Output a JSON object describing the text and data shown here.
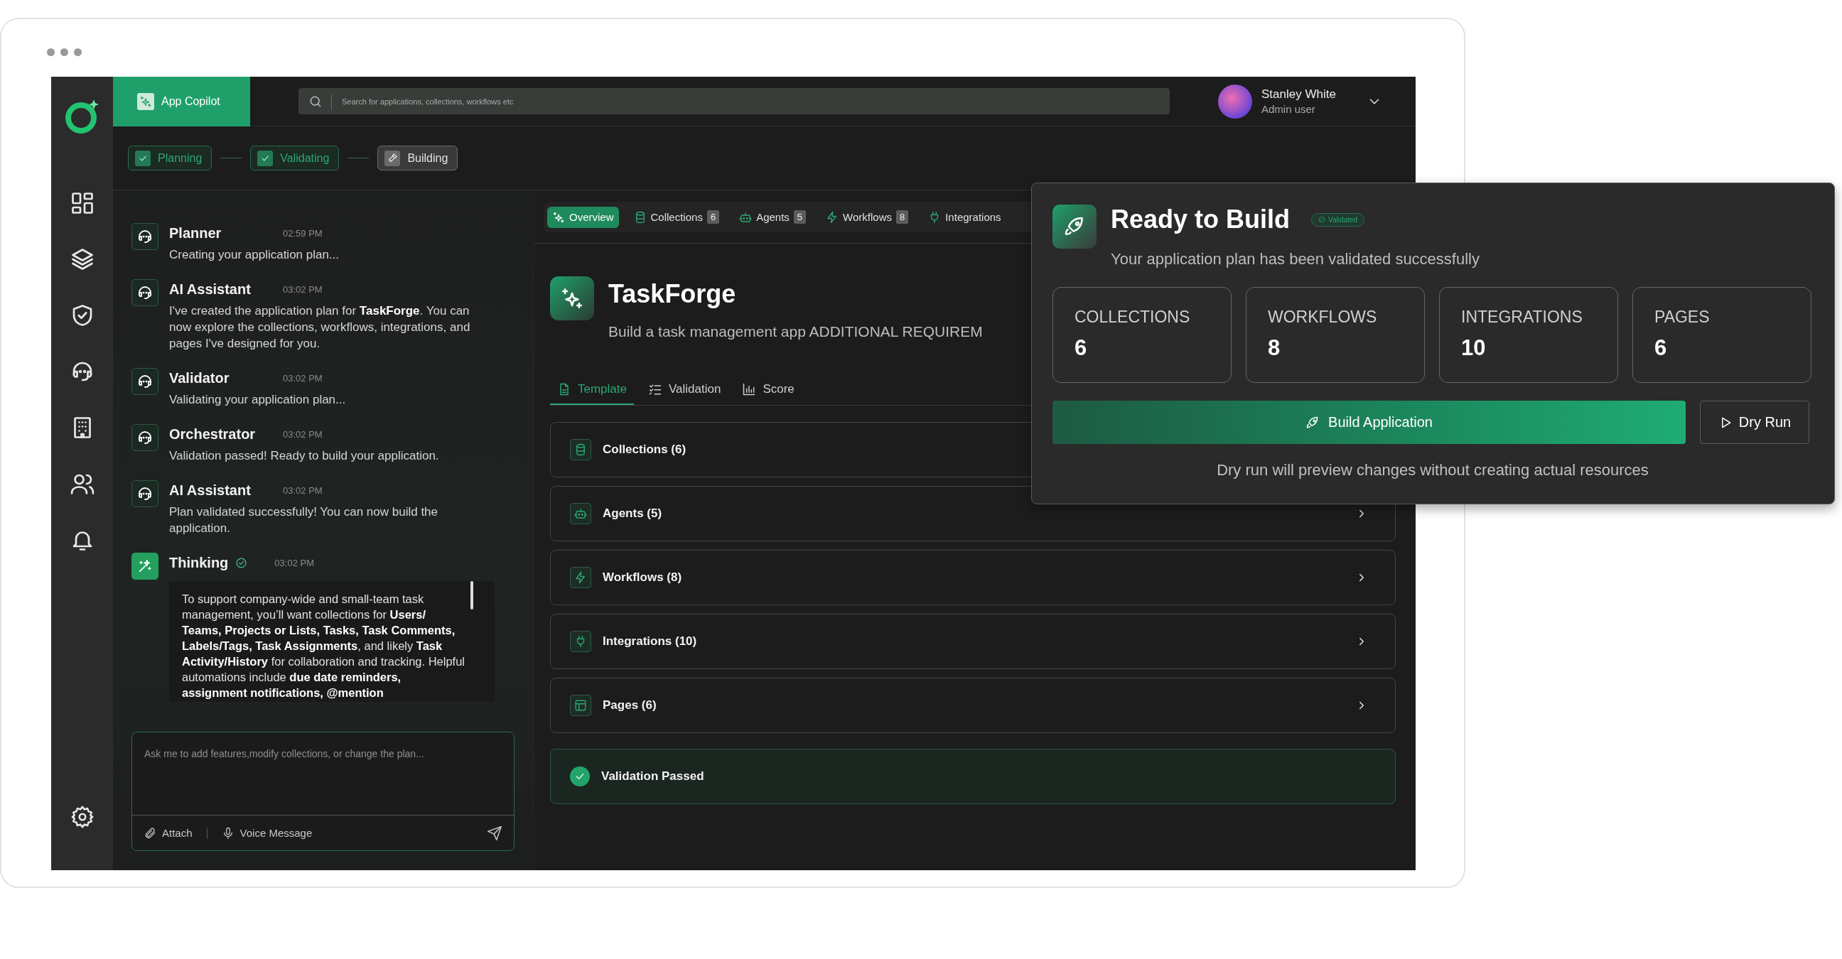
{
  "top_bar": {
    "copilot_button": "App Copilot",
    "search": {
      "placeholder": "Search for applications, collections, workflows etc"
    },
    "user": {
      "name": "Stanley White",
      "role": "Admin user"
    }
  },
  "steps": [
    {
      "label": "Planning",
      "done": true
    },
    {
      "label": "Validating",
      "done": true
    },
    {
      "label": "Building",
      "done": false
    }
  ],
  "chat": {
    "messages": [
      {
        "kind": "agent",
        "sender": "Planner",
        "time": "02:59 PM",
        "text": "Creating your application plan..."
      },
      {
        "kind": "agent",
        "sender": "AI Assistant",
        "time": "03:02 PM",
        "text": "I've created the application plan for **TaskForge**. You can now explore the collections, workflows, integrations, and pages I've designed for you."
      },
      {
        "kind": "agent",
        "sender": "Validator",
        "time": "03:02 PM",
        "text": "Validating your application plan..."
      },
      {
        "kind": "agent",
        "sender": "Orchestrator",
        "time": "03:02 PM",
        "text": "Validation passed! Ready to build your application."
      },
      {
        "kind": "agent",
        "sender": "AI Assistant",
        "time": "03:02 PM",
        "text": "Plan validated successfully! You can now build the application."
      },
      {
        "kind": "thinking",
        "sender": "Thinking",
        "time": "03:02 PM",
        "verified": true,
        "text": "To support company-wide and small-team task management, you’ll want collections for **Users/ Teams, Projects or Lists, Tasks, Task Comments, Labels/Tags, Task Assignments**, and likely **Task Activity/History** for collaboration and tracking. Helpful automations include **due date reminders, assignment notifications, @mention**"
      }
    ],
    "input": {
      "placeholder": "Ask me to add features,modify collections, or change the plan...",
      "attach": "Attach",
      "voice": "Voice Message"
    }
  },
  "tabs": [
    {
      "label": "Overview",
      "selected": true
    },
    {
      "label": "Collections",
      "count": "6",
      "selected": false
    },
    {
      "label": "Agents",
      "count": "5",
      "selected": false
    },
    {
      "label": "Workflows",
      "count": "8",
      "selected": false
    },
    {
      "label": "Integrations",
      "selected": false
    }
  ],
  "app": {
    "name": "TaskForge",
    "description": "Build a task management app ADDITIONAL REQUIREM"
  },
  "subtabs": [
    {
      "label": "Template",
      "selected": true
    },
    {
      "label": "Validation",
      "selected": false
    },
    {
      "label": "Score",
      "selected": false
    }
  ],
  "sections": [
    {
      "label": "Collections (6)",
      "chevron": false
    },
    {
      "label": "Agents (5)",
      "chevron": true
    },
    {
      "label": "Workflows (8)",
      "chevron": true
    },
    {
      "label": "Integrations (10)",
      "chevron": true
    },
    {
      "label": "Pages (6)",
      "chevron": true
    }
  ],
  "validation": {
    "label": "Validation Passed"
  },
  "build_card": {
    "title": "Ready to Build",
    "badge": "Validated",
    "subtitle": "Your application plan has been validated successfully",
    "stats": [
      {
        "label": "COLLECTIONS",
        "value": "6"
      },
      {
        "label": "WORKFLOWS",
        "value": "8"
      },
      {
        "label": "INTEGRATIONS",
        "value": "10"
      },
      {
        "label": "PAGES",
        "value": "6"
      }
    ],
    "primary_button": "Build Application",
    "secondary_button": "Dry Run",
    "note": "Dry run will preview changes without creating actual resources"
  }
}
